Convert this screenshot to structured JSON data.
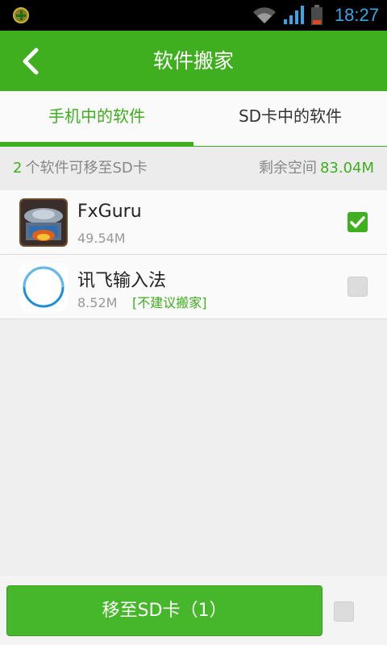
{
  "status_bar": {
    "time": "18:27",
    "icons": [
      "notification-icon",
      "wifi-icon",
      "signal-icon",
      "battery-icon"
    ]
  },
  "app_bar": {
    "title": "软件搬家",
    "back_icon": "chevron-left-icon"
  },
  "tabs": [
    {
      "label": "手机中的软件",
      "active": true
    },
    {
      "label": "SD卡中的软件",
      "active": false
    }
  ],
  "info": {
    "count": "2",
    "count_text": "个软件可移至SD卡",
    "space_label": "剩余空间",
    "space_value": "83.04M"
  },
  "apps": [
    {
      "name": "FxGuru",
      "size": "49.54M",
      "note": "",
      "checked": true,
      "icon": "fxguru-app-icon"
    },
    {
      "name": "讯飞输入法",
      "size": "8.52M",
      "note": "[不建议搬家]",
      "checked": false,
      "icon": "ifly-app-icon"
    }
  ],
  "bottom": {
    "button_label": "移至SD卡（1）"
  },
  "colors": {
    "accent": "#3fae1f",
    "status_time": "#3aa6e6"
  }
}
